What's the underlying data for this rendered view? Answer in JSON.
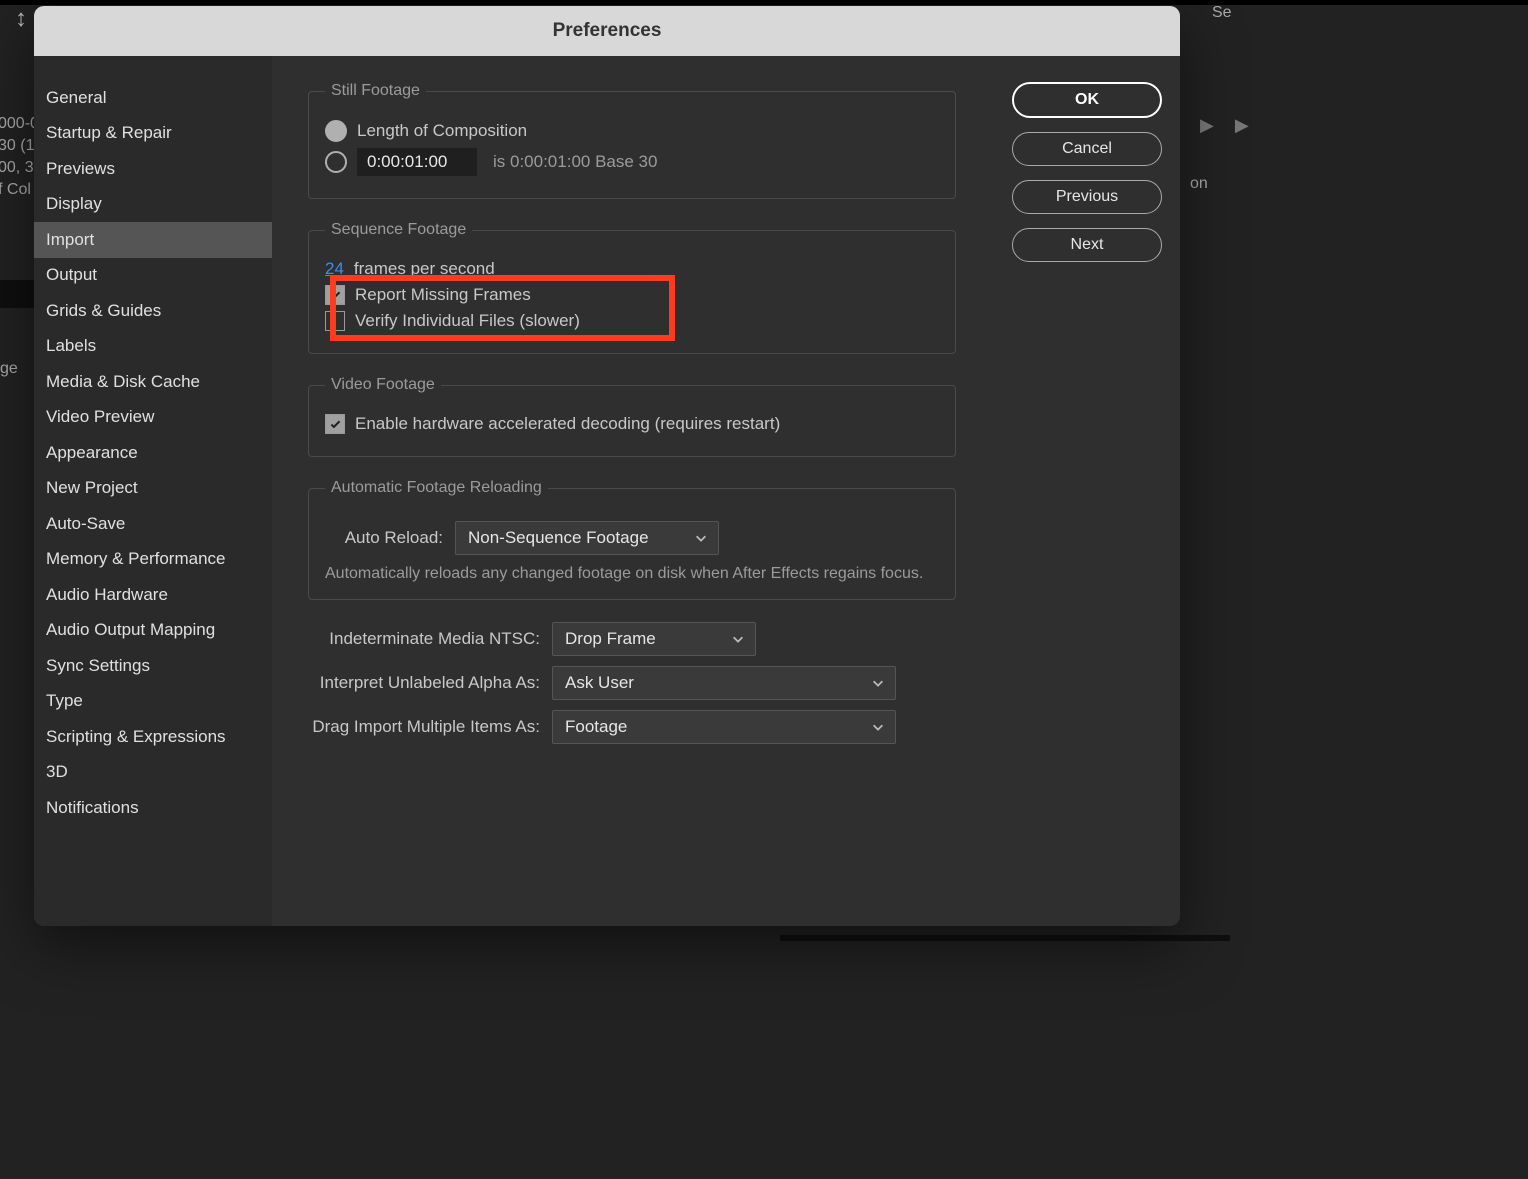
{
  "dialog": {
    "title": "Preferences"
  },
  "sidebar": {
    "items": [
      {
        "label": "General"
      },
      {
        "label": "Startup & Repair"
      },
      {
        "label": "Previews"
      },
      {
        "label": "Display"
      },
      {
        "label": "Import",
        "selected": true
      },
      {
        "label": "Output"
      },
      {
        "label": "Grids & Guides"
      },
      {
        "label": "Labels"
      },
      {
        "label": "Media & Disk Cache"
      },
      {
        "label": "Video Preview"
      },
      {
        "label": "Appearance"
      },
      {
        "label": "New Project"
      },
      {
        "label": "Auto-Save"
      },
      {
        "label": "Memory & Performance"
      },
      {
        "label": "Audio Hardware"
      },
      {
        "label": "Audio Output Mapping"
      },
      {
        "label": "Sync Settings"
      },
      {
        "label": "Type"
      },
      {
        "label": "Scripting & Expressions"
      },
      {
        "label": "3D"
      },
      {
        "label": "Notifications"
      }
    ]
  },
  "buttons": {
    "ok": "OK",
    "cancel": "Cancel",
    "previous": "Previous",
    "next": "Next"
  },
  "still": {
    "legend": "Still Footage",
    "optLength": "Length of Composition",
    "optTime": "0:00:01:00",
    "timeHint": "is 0:00:01:00  Base 30"
  },
  "sequence": {
    "legend": "Sequence Footage",
    "fpsValue": "24",
    "fpsUnit": " frames per second",
    "reportMissing": "Report Missing Frames",
    "verify": "Verify Individual Files (slower)"
  },
  "video": {
    "legend": "Video Footage",
    "hwDecode": "Enable hardware accelerated decoding (requires restart)"
  },
  "reload": {
    "legend": "Automatic Footage Reloading",
    "label": "Auto Reload:",
    "value": "Non-Sequence Footage",
    "desc": "Automatically reloads any changed footage on disk when After Effects regains focus."
  },
  "ntsc": {
    "label": "Indeterminate Media NTSC:",
    "value": "Drop Frame"
  },
  "alpha": {
    "label": "Interpret Unlabeled Alpha As:",
    "value": "Ask User"
  },
  "drag": {
    "label": "Drag Import Multiple Items As:",
    "value": "Footage"
  },
  "bg": {
    "l1": "000-0",
    "l2": "30 (1",
    "l3": "00, 3",
    "l4": "f Col",
    "r1": "Se",
    "r2": "on",
    "l7": "ge",
    "tool": "↕"
  }
}
